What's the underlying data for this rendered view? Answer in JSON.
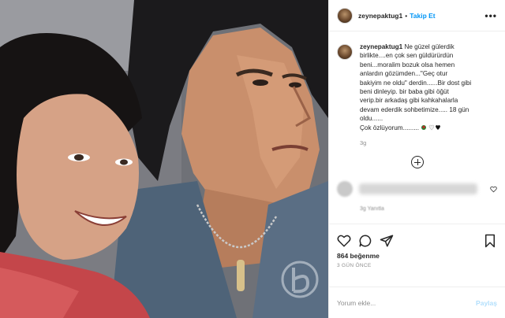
{
  "header": {
    "username": "zeynepaktug1",
    "separator": "•",
    "follow_label": "Takip Et",
    "more_label": "•••"
  },
  "caption": {
    "username": "zeynepaktug1",
    "lines": [
      "Ne güzel gülerdik",
      "birlikte....en çok sen güldürürdün",
      "beni...moralim bozuk olsa hemen",
      "anlardın gözümden...\"Geç otur",
      "bakiyim ne oldu\" derdin......Bir dost gibi",
      "beni dinleyip. bir baba gibi öğüt",
      "verip.bir arkadaş gibi kahkahalarla",
      "devam ederdik sohbetimize..... 18 gün",
      "oldu......",
      "Çok özlüyorum........."
    ],
    "time": "3g"
  },
  "hidden_comment": {
    "meta": "3g   Yanıtla"
  },
  "actions": {
    "like_icon": "heart-icon",
    "comment_icon": "comment-icon",
    "share_icon": "paper-plane-icon",
    "save_icon": "bookmark-icon"
  },
  "likes_text": "864 beğenme",
  "date_text": "3 GÜN ÖNCE",
  "comment_input": {
    "placeholder": "Yorum ekle...",
    "post_label": "Paylaş"
  },
  "colors": {
    "accent": "#0095f6",
    "post_disabled": "#b2dffc",
    "muted": "#8e8e8e"
  }
}
